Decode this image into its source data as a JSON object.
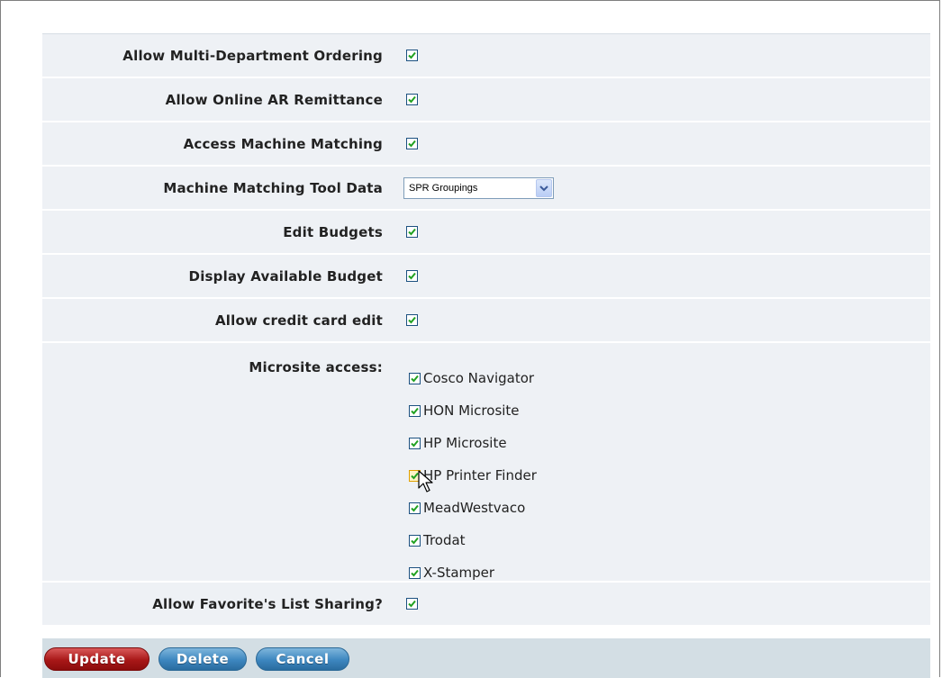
{
  "settings": [
    {
      "label": "Allow Multi-Department Ordering",
      "checked": true
    },
    {
      "label": "Allow Online AR Remittance",
      "checked": true
    },
    {
      "label": "Access Machine Matching",
      "checked": true
    },
    {
      "label": "Machine Matching Tool Data",
      "select_value": "SPR Groupings"
    },
    {
      "label": "Edit Budgets",
      "checked": true
    },
    {
      "label": "Display Available Budget",
      "checked": true
    },
    {
      "label": "Allow credit card edit",
      "checked": true
    }
  ],
  "microsite": {
    "label": "Microsite access:",
    "items": [
      {
        "label": "Cosco Navigator",
        "checked": true
      },
      {
        "label": "HON Microsite",
        "checked": true
      },
      {
        "label": "HP Microsite",
        "checked": true
      },
      {
        "label": "HP Printer Finder",
        "checked": true
      },
      {
        "label": "MeadWestvaco",
        "checked": true
      },
      {
        "label": "Trodat",
        "checked": true
      },
      {
        "label": "X-Stamper",
        "checked": true
      }
    ]
  },
  "favorites_sharing": {
    "label": "Allow Favorite's List Sharing?",
    "checked": true
  },
  "buttons": {
    "update": "Update",
    "delete": "Delete",
    "cancel": "Cancel"
  },
  "colors": {
    "row_bg": "#eef1f5",
    "button_bar_bg": "#d3dee4",
    "checkmark": "#21a121",
    "update_button": "#a81818",
    "secondary_button": "#3d86bf"
  },
  "icons": {
    "checkbox": "checkmark-icon",
    "select_arrow": "chevron-down-icon",
    "cursor": "mouse-pointer-icon"
  }
}
